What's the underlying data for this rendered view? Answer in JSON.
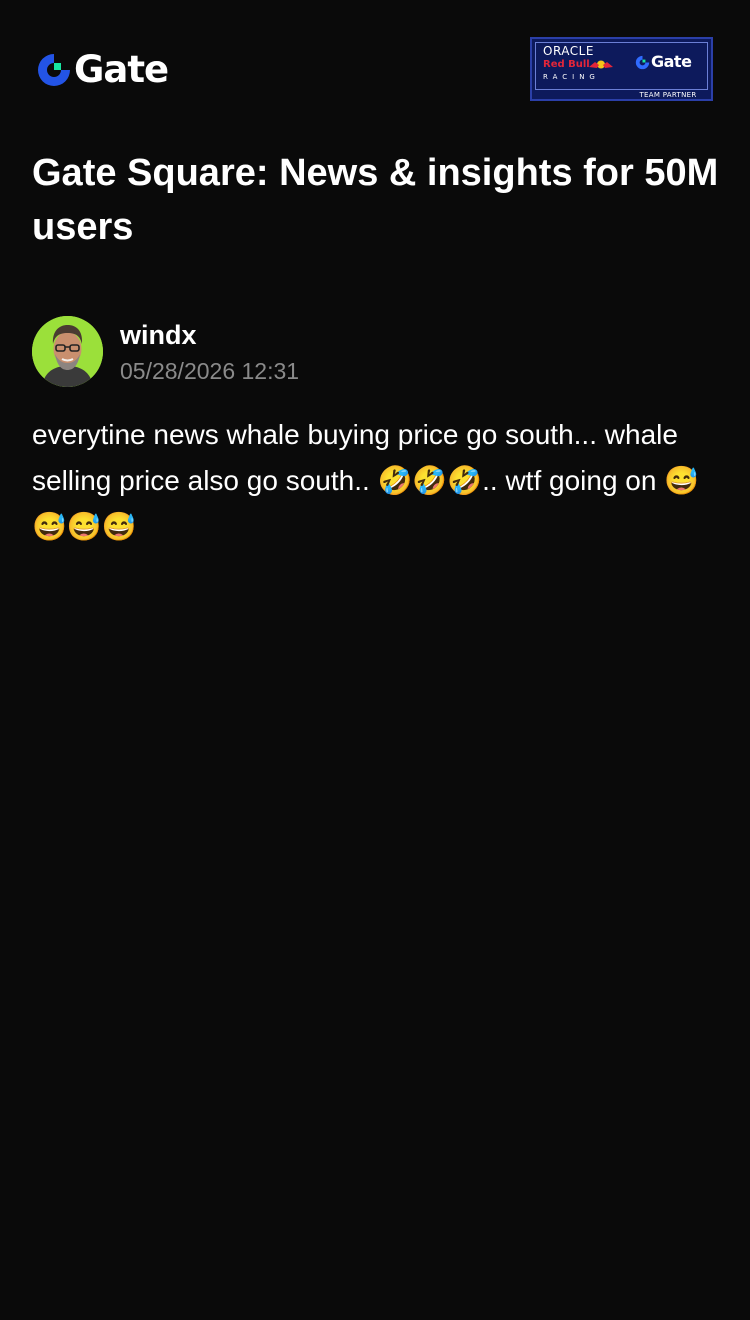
{
  "header": {
    "logo_text": "Gate",
    "partner_badge": {
      "line1": "ORACLE",
      "line2": "Red Bull",
      "line3": "RACING",
      "brand": "Gate",
      "footer": "TEAM PARTNER"
    }
  },
  "page": {
    "title": "Gate Square: News & insights for 50M users"
  },
  "post": {
    "author": "windx",
    "timestamp": "05/28/2026 12:31",
    "body": "everytine news whale buying price go south... whale selling price also go south.. 🤣🤣🤣.. wtf going on 😅😅😅😅"
  },
  "colors": {
    "background": "#0a0a0a",
    "brand_blue": "#2354e6",
    "brand_green": "#17e6a1",
    "muted_text": "#8a8a8a",
    "badge_navy": "#0d1a5c"
  },
  "icons": {
    "logo": "gate-logo-icon",
    "avatar": "user-avatar"
  }
}
